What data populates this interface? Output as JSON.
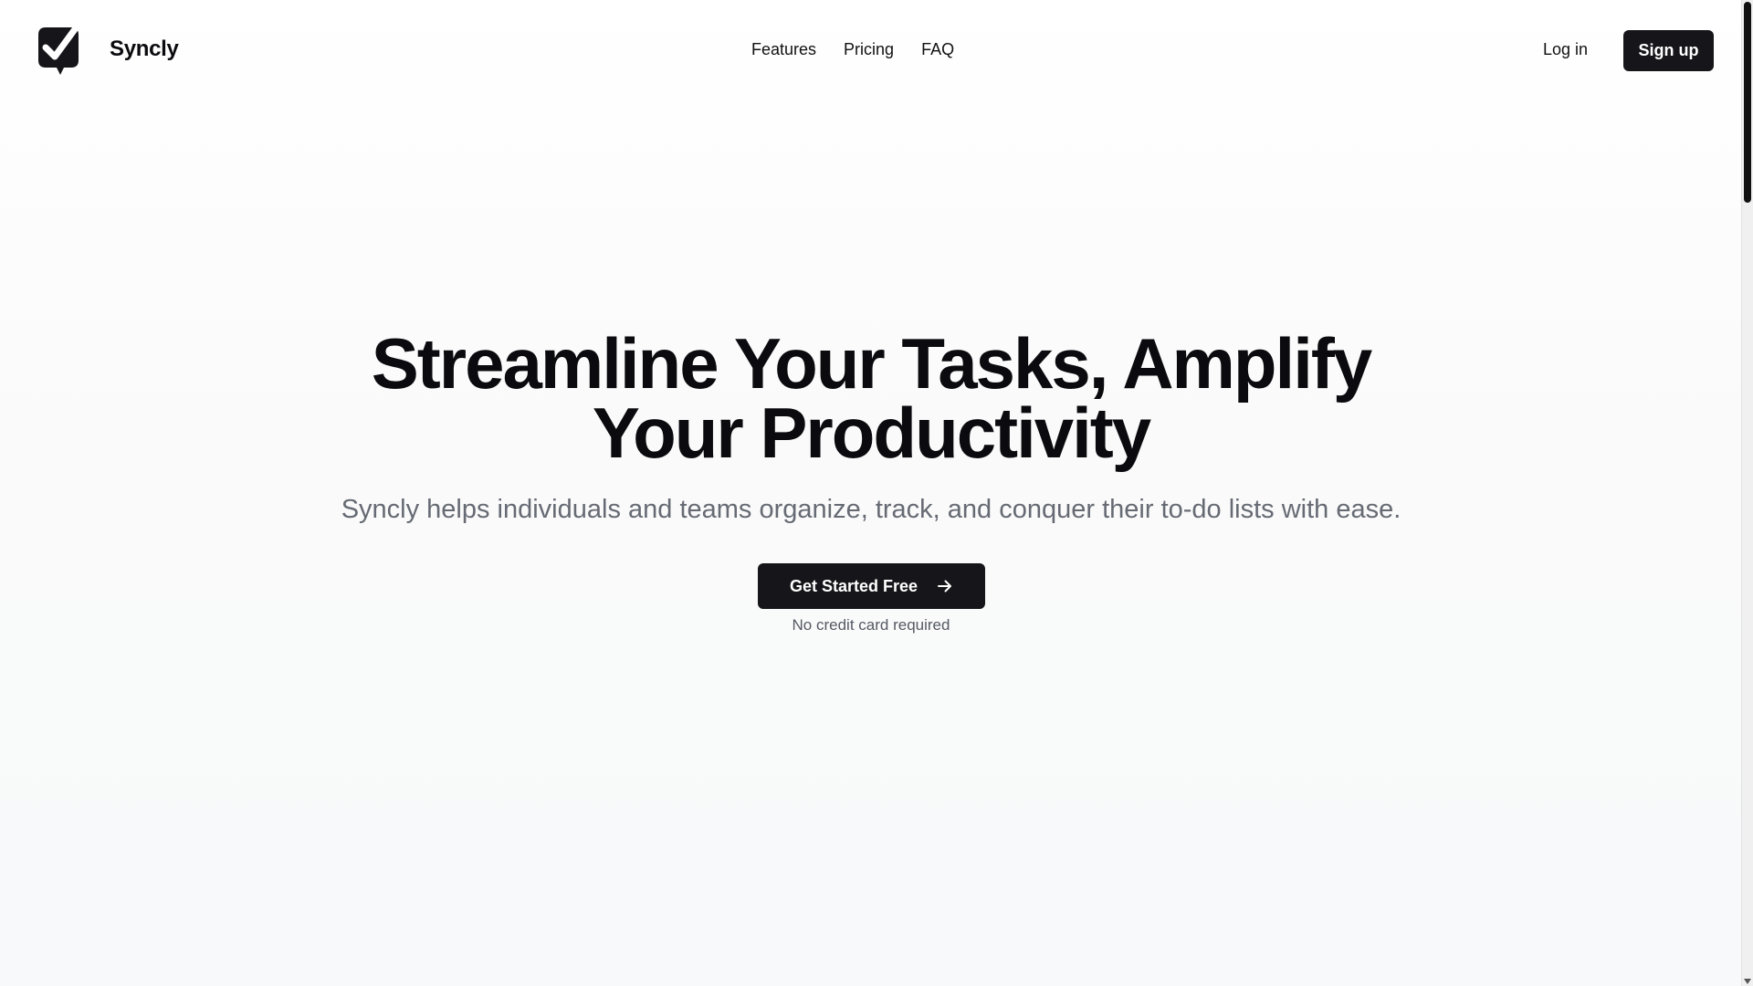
{
  "brand": {
    "name": "Syncly",
    "logo_icon": "check-chat-icon"
  },
  "nav": {
    "items": [
      {
        "label": "Features"
      },
      {
        "label": "Pricing"
      },
      {
        "label": "FAQ"
      }
    ]
  },
  "auth": {
    "login_label": "Log in",
    "signup_label": "Sign up"
  },
  "hero": {
    "title": "Streamline Your Tasks, Amplify Your Productivity",
    "subtitle": "Syncly helps individuals and teams organize, track, and conquer their to-do lists with ease.",
    "cta_label": "Get Started Free",
    "cta_icon": "arrow-right-icon",
    "note": "No credit card required"
  },
  "colors": {
    "primary": "#16161a",
    "text": "#0b0b0f",
    "muted": "#666a73"
  }
}
